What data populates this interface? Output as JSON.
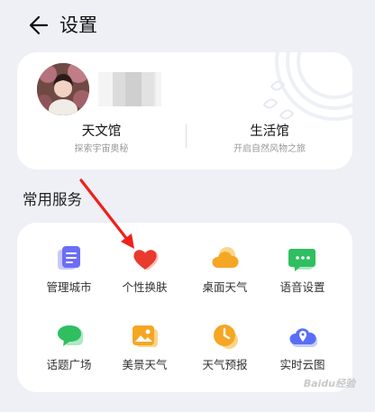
{
  "header": {
    "title": "设置"
  },
  "profile": {
    "left": {
      "title": "天文馆",
      "subtitle": "探索宇宙奥秘"
    },
    "right": {
      "title": "生活馆",
      "subtitle": "开启自然风物之旅"
    }
  },
  "section_title": "常用服务",
  "services": [
    {
      "label": "管理城市",
      "icon": "manage-city-icon",
      "color": "#6b6ef7"
    },
    {
      "label": "个性换肤",
      "icon": "heart-icon",
      "color": "#e83a2d"
    },
    {
      "label": "桌面天气",
      "icon": "cloud-icon",
      "color": "#f5a623"
    },
    {
      "label": "语音设置",
      "icon": "chat-bubble-icon",
      "color": "#2fbf60"
    },
    {
      "label": "话题广场",
      "icon": "speech-bubble-icon",
      "color": "#2fbf60"
    },
    {
      "label": "美景天气",
      "icon": "landscape-image-icon",
      "color": "#f5a623"
    },
    {
      "label": "天气预报",
      "icon": "clock-icon",
      "color": "#f5a623"
    },
    {
      "label": "实时云图",
      "icon": "cloud-pin-icon",
      "color": "#5b6ef7"
    }
  ],
  "watermark": "Baidu经验"
}
